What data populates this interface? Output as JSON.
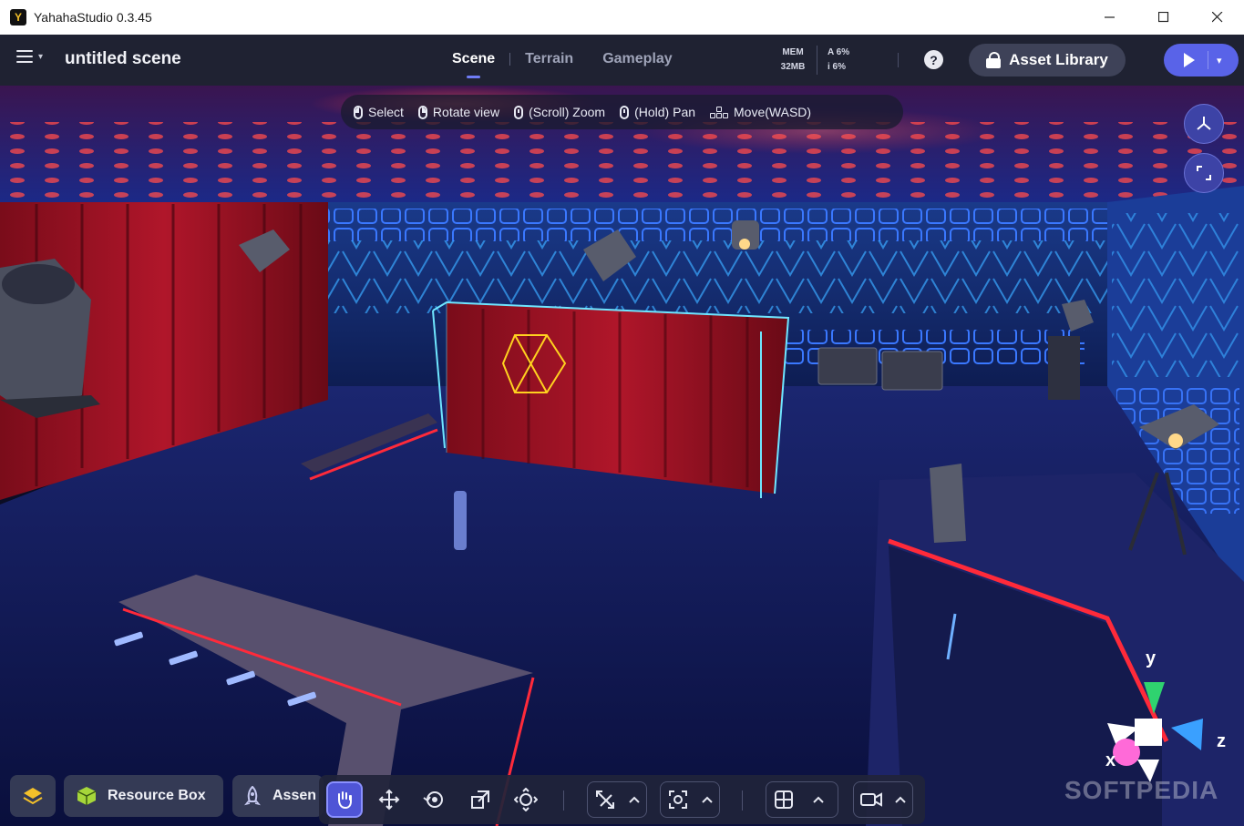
{
  "window": {
    "title": "YahahaStudio 0.3.45",
    "controls": [
      "minimize",
      "maximize",
      "close"
    ]
  },
  "header": {
    "scene_name": "untitled scene",
    "tabs": [
      {
        "label": "Scene",
        "active": true
      },
      {
        "label": "Terrain",
        "active": false
      },
      {
        "label": "Gameplay",
        "active": false
      }
    ],
    "mem_label": "MEM",
    "mem_value": "32MB",
    "perf_a": "A 6%",
    "perf_i": "i 6%",
    "help_label": "?",
    "asset_library_label": "Asset Library"
  },
  "hints": [
    {
      "icon": "mouse-left-icon",
      "label": "Select"
    },
    {
      "icon": "mouse-right-icon",
      "label": "Rotate view"
    },
    {
      "icon": "mouse-scroll-icon",
      "label": "(Scroll) Zoom"
    },
    {
      "icon": "mouse-middle-icon",
      "label": "(Hold) Pan"
    },
    {
      "icon": "wasd-keys-icon",
      "label": "Move(WASD)"
    }
  ],
  "dock": {
    "resource_box_label": "Resource Box",
    "assets_label": "Assen"
  },
  "toolbar": {
    "tools": [
      {
        "name": "hand-tool",
        "active": true
      },
      {
        "name": "move-tool",
        "active": false
      },
      {
        "name": "rotate-tool",
        "active": false
      },
      {
        "name": "scale-tool",
        "active": false
      },
      {
        "name": "transform-tool",
        "active": false
      }
    ]
  },
  "gizmo": {
    "x_label": "x",
    "y_label": "y",
    "z_label": "z"
  },
  "watermark": "SOFTPEDIA",
  "colors": {
    "accent": "#5963e8",
    "header_bg": "#1f2232",
    "neon_red": "#ff2a3a",
    "neon_blue": "#3a7cff",
    "selection_cyan": "#6fe6ff",
    "selection_yellow": "#ffd21f"
  }
}
